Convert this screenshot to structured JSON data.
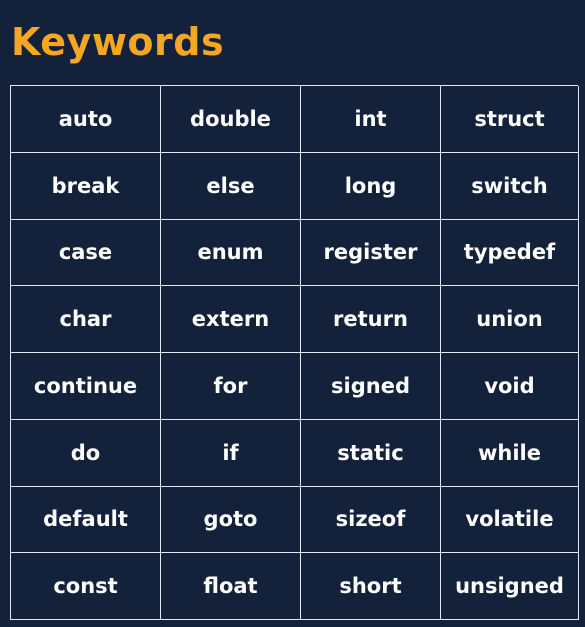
{
  "title": "Keywords",
  "colors": {
    "background": "#14213a",
    "title": "#f5a623",
    "text": "#ffffff",
    "border": "#e6e9f0"
  },
  "keywords": [
    [
      "auto",
      "double",
      "int",
      "struct"
    ],
    [
      "break",
      "else",
      "long",
      "switch"
    ],
    [
      "case",
      "enum",
      "register",
      "typedef"
    ],
    [
      "char",
      "extern",
      "return",
      "union"
    ],
    [
      "continue",
      "for",
      "signed",
      "void"
    ],
    [
      "do",
      "if",
      "static",
      "while"
    ],
    [
      "default",
      "goto",
      "sizeof",
      "volatile"
    ],
    [
      "const",
      "float",
      "short",
      "unsigned"
    ]
  ]
}
